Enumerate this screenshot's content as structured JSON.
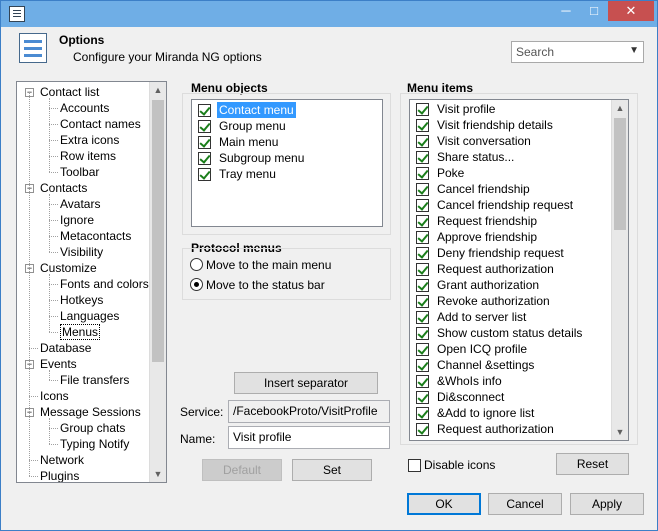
{
  "window": {
    "title_min": "─",
    "title_max": "□",
    "title_close": "✕"
  },
  "header": {
    "title": "Options",
    "subtitle": "Configure your Miranda NG options",
    "search_placeholder": "Search"
  },
  "tree": {
    "items": [
      {
        "label": "Contact list",
        "level": 0,
        "toggle": "−"
      },
      {
        "label": "Accounts",
        "level": 1
      },
      {
        "label": "Contact names",
        "level": 1
      },
      {
        "label": "Extra icons",
        "level": 1
      },
      {
        "label": "Row items",
        "level": 1
      },
      {
        "label": "Toolbar",
        "level": 1
      },
      {
        "label": "Contacts",
        "level": 0,
        "toggle": "−"
      },
      {
        "label": "Avatars",
        "level": 1
      },
      {
        "label": "Ignore",
        "level": 1
      },
      {
        "label": "Metacontacts",
        "level": 1
      },
      {
        "label": "Visibility",
        "level": 1
      },
      {
        "label": "Customize",
        "level": 0,
        "toggle": "−"
      },
      {
        "label": "Fonts and colors",
        "level": 1
      },
      {
        "label": "Hotkeys",
        "level": 1
      },
      {
        "label": "Languages",
        "level": 1
      },
      {
        "label": "Menus",
        "level": 1,
        "selected": true
      },
      {
        "label": "Database",
        "level": 0
      },
      {
        "label": "Events",
        "level": 0,
        "toggle": "−"
      },
      {
        "label": "File transfers",
        "level": 1
      },
      {
        "label": "Icons",
        "level": 0
      },
      {
        "label": "Message Sessions",
        "level": 0,
        "toggle": "−"
      },
      {
        "label": "Group chats",
        "level": 1
      },
      {
        "label": "Typing Notify",
        "level": 1
      },
      {
        "label": "Network",
        "level": 0
      },
      {
        "label": "Plugins",
        "level": 0
      }
    ]
  },
  "menu_objects": {
    "title": "Menu objects",
    "items": [
      {
        "label": "Contact menu",
        "checked": true,
        "selected": true
      },
      {
        "label": "Group menu",
        "checked": true
      },
      {
        "label": "Main menu",
        "checked": true
      },
      {
        "label": "Subgroup menu",
        "checked": true
      },
      {
        "label": "Tray menu",
        "checked": true
      }
    ]
  },
  "protocol_menus": {
    "title": "Protocol menus",
    "options": [
      {
        "label": "Move to the main menu",
        "selected": false
      },
      {
        "label": "Move to the status bar",
        "selected": true
      }
    ]
  },
  "menu_items": {
    "title": "Menu items",
    "items": [
      "Visit profile",
      "Visit friendship details",
      "Visit conversation",
      "Share status...",
      "Poke",
      "Cancel friendship",
      "Cancel friendship request",
      "Request friendship",
      "Approve friendship",
      "Deny friendship request",
      "Request authorization",
      "Grant authorization",
      "Revoke authorization",
      "Add to server list",
      "Show custom status details",
      "Open ICQ profile",
      "Channel &settings",
      "&WhoIs info",
      "Di&sconnect",
      "&Add to ignore list",
      "Request authorization"
    ]
  },
  "form": {
    "insert_separator": "Insert separator",
    "service_label": "Service:",
    "service_value": "/FacebookProto/VisitProfile",
    "name_label": "Name:",
    "name_value": "Visit profile",
    "default_button": "Default",
    "set_button": "Set",
    "disable_icons": "Disable icons",
    "reset_button": "Reset"
  },
  "footer": {
    "ok": "OK",
    "cancel": "Cancel",
    "apply": "Apply"
  }
}
